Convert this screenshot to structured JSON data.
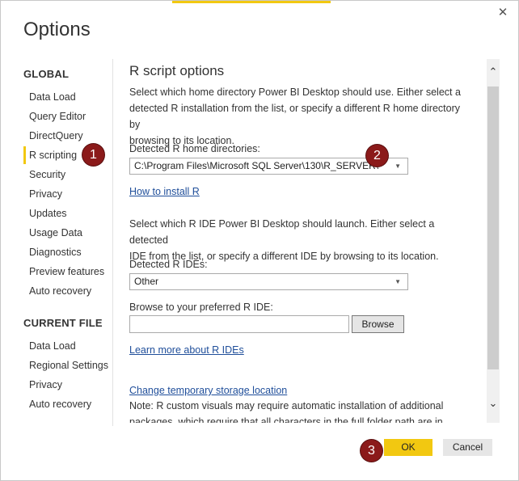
{
  "dialog": {
    "title": "Options",
    "close_icon": "close-icon",
    "accent_color": "#f2c811"
  },
  "sidebar": {
    "global_heading": "GLOBAL",
    "global_items": [
      {
        "label": "Data Load"
      },
      {
        "label": "Query Editor"
      },
      {
        "label": "DirectQuery"
      },
      {
        "label": "R scripting",
        "active": true
      },
      {
        "label": "Security"
      },
      {
        "label": "Privacy"
      },
      {
        "label": "Updates"
      },
      {
        "label": "Usage Data"
      },
      {
        "label": "Diagnostics"
      },
      {
        "label": "Preview features"
      },
      {
        "label": "Auto recovery"
      }
    ],
    "file_heading": "CURRENT FILE",
    "file_items": [
      {
        "label": "Data Load"
      },
      {
        "label": "Regional Settings"
      },
      {
        "label": "Privacy"
      },
      {
        "label": "Auto recovery"
      }
    ]
  },
  "content": {
    "heading": "R script options",
    "home_intro_lines": [
      "Select which home directory Power BI Desktop should use. Either select a",
      "detected R installation from the list, or specify a different R home directory by",
      "browsing to its location."
    ],
    "home_label": "Detected R home directories:",
    "home_value": "C:\\Program Files\\Microsoft SQL Server\\130\\R_SERVER\\",
    "install_link": "How to install R",
    "ide_intro_lines": [
      "Select which R IDE Power BI Desktop should launch. Either select a detected",
      "IDE from the list, or specify a different IDE by browsing to its location."
    ],
    "ide_label": "Detected R IDEs:",
    "ide_value": "Other",
    "browse_label": "Browse to your preferred R IDE:",
    "browse_input_value": "",
    "browse_button": "Browse",
    "learn_link": "Learn more about R IDEs",
    "storage_link": "Change temporary storage location",
    "note_lines": [
      "Note: R custom visuals may require automatic installation of additional",
      "packages, which require that all characters in the full folder path are in"
    ]
  },
  "footer": {
    "ok_label": "OK",
    "cancel_label": "Cancel"
  },
  "annotations": [
    {
      "label": "1",
      "color": "#8b1a1a"
    },
    {
      "label": "2",
      "color": "#8b1a1a"
    },
    {
      "label": "3",
      "color": "#8b1a1a"
    }
  ]
}
